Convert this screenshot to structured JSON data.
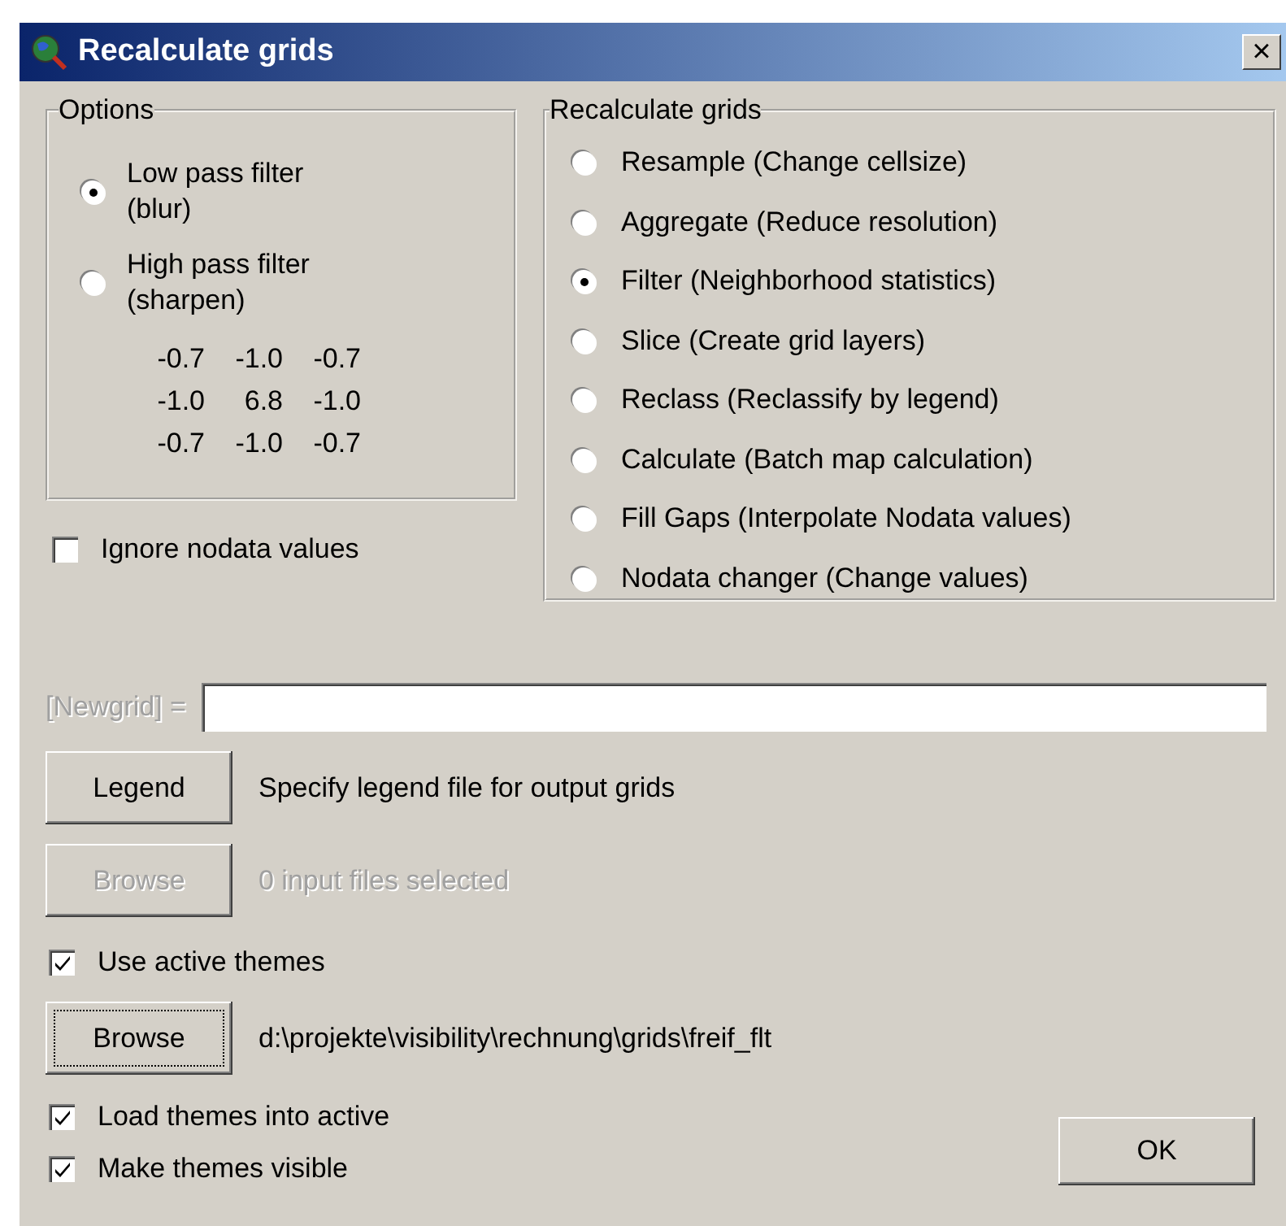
{
  "window": {
    "title": "Recalculate grids",
    "close": "×"
  },
  "options": {
    "title": "Options",
    "items": [
      {
        "label": "Low pass filter (blur)",
        "selected": true
      },
      {
        "label": "High pass filter (sharpen)",
        "selected": false
      }
    ],
    "matrix": [
      [
        "-0.7",
        "-1.0",
        "-0.7"
      ],
      [
        "-1.0",
        "6.8",
        "-1.0"
      ],
      [
        "-0.7",
        "-1.0",
        "-0.7"
      ]
    ]
  },
  "ignore_nodata": {
    "label": "Ignore nodata values",
    "checked": false
  },
  "recalculate": {
    "title": "Recalculate grids",
    "items": [
      {
        "label": "Resample (Change cellsize)",
        "selected": false
      },
      {
        "label": "Aggregate (Reduce resolution)",
        "selected": false
      },
      {
        "label": "Filter (Neighborhood statistics)",
        "selected": true
      },
      {
        "label": "Slice (Create grid layers)",
        "selected": false
      },
      {
        "label": "Reclass (Reclassify by legend)",
        "selected": false
      },
      {
        "label": "Calculate (Batch map calculation)",
        "selected": false
      },
      {
        "label": "Fill Gaps (Interpolate Nodata values)",
        "selected": false
      },
      {
        "label": "Nodata changer (Change values)",
        "selected": false
      }
    ]
  },
  "newgrid": {
    "label": "[Newgrid] =",
    "disabled": true
  },
  "rows": [
    {
      "kind": "button",
      "button": "Legend",
      "disabled": false,
      "focused": false,
      "text": "Specify legend file for output grids"
    },
    {
      "kind": "button",
      "button": "Browse",
      "disabled": true,
      "focused": false,
      "text": "0 input files selected"
    },
    {
      "kind": "checkbox",
      "label": "Use active themes",
      "checked": true
    },
    {
      "kind": "button",
      "button": "Browse",
      "disabled": false,
      "focused": true,
      "text": "d:\\projekte\\visibility\\rechnung\\grids\\freif_flt"
    }
  ],
  "bottom_checks": [
    {
      "label": "Load themes into active",
      "checked": true
    },
    {
      "label": "Make themes visible",
      "checked": true
    }
  ],
  "ok_button": "OK"
}
